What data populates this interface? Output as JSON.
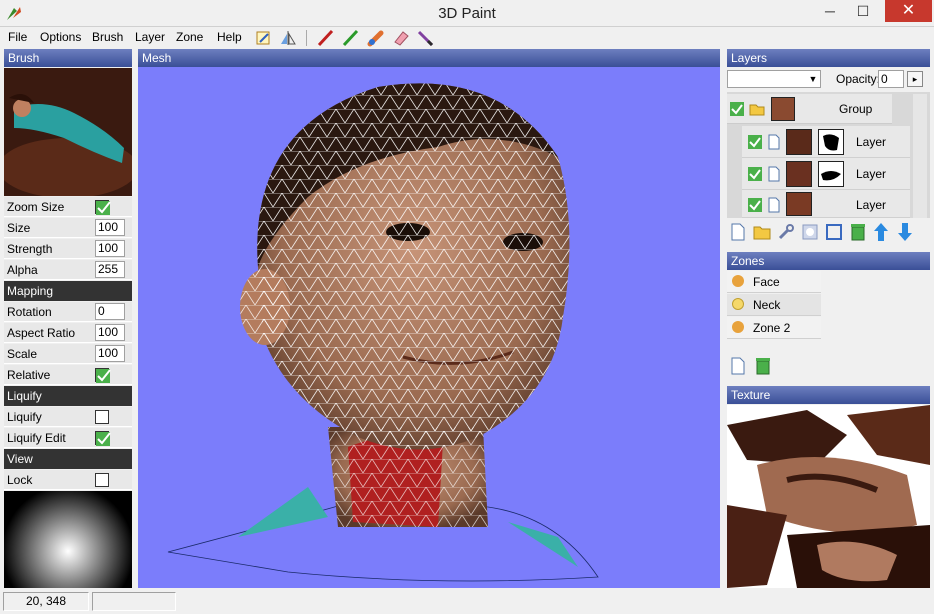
{
  "window": {
    "title": "3D Paint",
    "min": "─",
    "max": "☐",
    "close": "✕"
  },
  "menu": [
    "File",
    "Options",
    "Brush",
    "Layer",
    "Zone",
    "Help"
  ],
  "toolbar_icons": [
    "paint-icon",
    "mirror-icon",
    "brush-red-icon",
    "brush-green-icon",
    "smudge-icon",
    "eraser-icon",
    "pencil-icon"
  ],
  "brush_panel": {
    "title": "Brush",
    "rows": [
      {
        "label": "Zoom Size",
        "type": "check",
        "checked": true
      },
      {
        "label": "Size",
        "value": "100"
      },
      {
        "label": "Strength",
        "value": "100"
      },
      {
        "label": "Alpha",
        "value": "255"
      }
    ],
    "mapping": {
      "title": "Mapping",
      "rows": [
        {
          "label": "Rotation",
          "value": "0"
        },
        {
          "label": "Aspect Ratio",
          "value": "100"
        },
        {
          "label": "Scale",
          "value": "100"
        },
        {
          "label": "Relative",
          "type": "check",
          "checked": true
        }
      ]
    },
    "liquify": {
      "title": "Liquify",
      "rows": [
        {
          "label": "Liquify",
          "type": "check",
          "checked": false
        },
        {
          "label": "Liquify Edit",
          "type": "check",
          "checked": true
        }
      ]
    },
    "view": {
      "title": "View",
      "rows": [
        {
          "label": "Lock",
          "type": "check",
          "checked": false
        }
      ]
    }
  },
  "mesh": {
    "title": "Mesh",
    "bg": "#7b7dfb"
  },
  "layers": {
    "title": "Layers",
    "opacity_label": "Opacity:",
    "opacity_value": "0",
    "group_label": "Group",
    "items": [
      {
        "label": "Layer"
      },
      {
        "label": "Layer"
      },
      {
        "label": "Layer"
      }
    ]
  },
  "zones": {
    "title": "Zones",
    "items": [
      {
        "label": "Face",
        "color": "#e8a23c"
      },
      {
        "label": "Neck",
        "color": "#f5d86a"
      },
      {
        "label": "Zone 2",
        "color": "#e8a23c"
      }
    ]
  },
  "texture": {
    "title": "Texture"
  },
  "status": {
    "coords": "20, 348"
  }
}
